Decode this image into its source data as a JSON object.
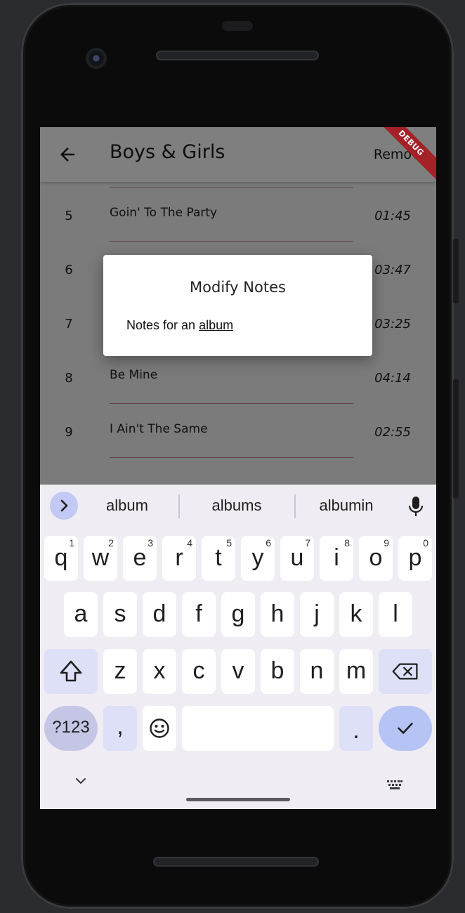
{
  "appbar": {
    "title": "Boys & Girls",
    "action": "Remove",
    "debug_label": "DEBUG"
  },
  "tracks": [
    {
      "num": "5",
      "title": "Goin' To The Party",
      "duration": "01:45"
    },
    {
      "num": "6",
      "title": "",
      "duration": "03:47"
    },
    {
      "num": "7",
      "title": "",
      "duration": "03:25"
    },
    {
      "num": "8",
      "title": "Be Mine",
      "duration": "04:14"
    },
    {
      "num": "9",
      "title": "I Ain't The Same",
      "duration": "02:55"
    }
  ],
  "dialog": {
    "title": "Modify Notes",
    "body_prefix": "Notes for an ",
    "body_word": "album"
  },
  "keyboard": {
    "suggestions": [
      "album",
      "albums",
      "albumin"
    ],
    "row1": [
      {
        "k": "q",
        "h": "1"
      },
      {
        "k": "w",
        "h": "2"
      },
      {
        "k": "e",
        "h": "3"
      },
      {
        "k": "r",
        "h": "4"
      },
      {
        "k": "t",
        "h": "5"
      },
      {
        "k": "y",
        "h": "6"
      },
      {
        "k": "u",
        "h": "7"
      },
      {
        "k": "i",
        "h": "8"
      },
      {
        "k": "o",
        "h": "9"
      },
      {
        "k": "p",
        "h": "0"
      }
    ],
    "row2": [
      "a",
      "s",
      "d",
      "f",
      "g",
      "h",
      "j",
      "k",
      "l"
    ],
    "row3": [
      "z",
      "x",
      "c",
      "v",
      "b",
      "n",
      "m"
    ],
    "sym_label": "?123",
    "comma_label": ",",
    "period_label": ".",
    "colors": {
      "background": "#efedf3",
      "accent": "#b5c3f5"
    }
  }
}
